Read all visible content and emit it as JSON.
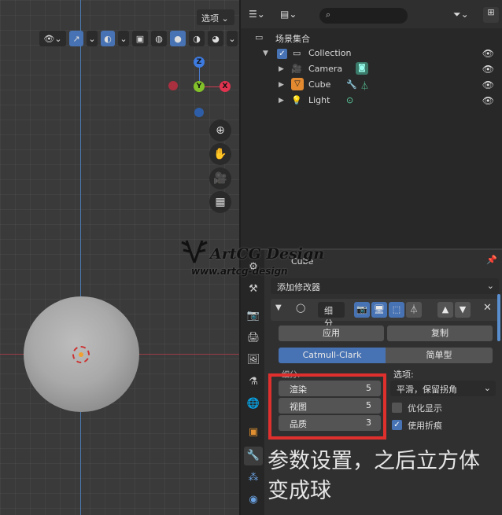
{
  "viewport": {
    "options_label": "选项",
    "gizmo": {
      "z": "Z",
      "y": "Y",
      "x": "X"
    },
    "icons": [
      "visibility-dropdown-icon",
      "gizmo-toggle-icon",
      "overlay-toggle-icon",
      "xray-icon",
      "wireframe-shading-icon",
      "solid-shading-icon",
      "material-shading-icon",
      "rendered-shading-icon",
      "zoom-icon",
      "pan-hand-icon",
      "camera-view-icon",
      "ortho-grid-icon"
    ]
  },
  "outliner": {
    "scene_collection": "场景集合",
    "items": [
      {
        "label": "Collection",
        "indent": 1
      },
      {
        "label": "Camera",
        "indent": 2,
        "color": "#c88a2e"
      },
      {
        "label": "Cube",
        "indent": 2,
        "color": "#e38a30"
      },
      {
        "label": "Light",
        "indent": 2,
        "color": "#e38a30"
      }
    ]
  },
  "properties": {
    "object_name": "Cube",
    "add_modifier": "添加修改器",
    "modifier_name": "细分",
    "apply": "应用",
    "copy": "复制",
    "algorithm_catmull": "Catmull-Clark",
    "algorithm_simple": "简单型",
    "subdiv_label": "细分:",
    "options_label": "选项:",
    "render_label": "渲染",
    "render_value": "5",
    "viewport_label": "视图",
    "viewport_value": "5",
    "quality_label": "品质",
    "quality_value": "3",
    "uv_smooth": "平滑，保留拐角",
    "optimal_display": "优化显示",
    "use_creases": "使用折痕"
  },
  "caption": "参数设置，之后立方体变成球",
  "watermark": {
    "title": "ArtCG Design",
    "url": "www.artcg-design"
  },
  "colors": {
    "accent": "#4772b3",
    "highlight_box": "#e0302e"
  }
}
